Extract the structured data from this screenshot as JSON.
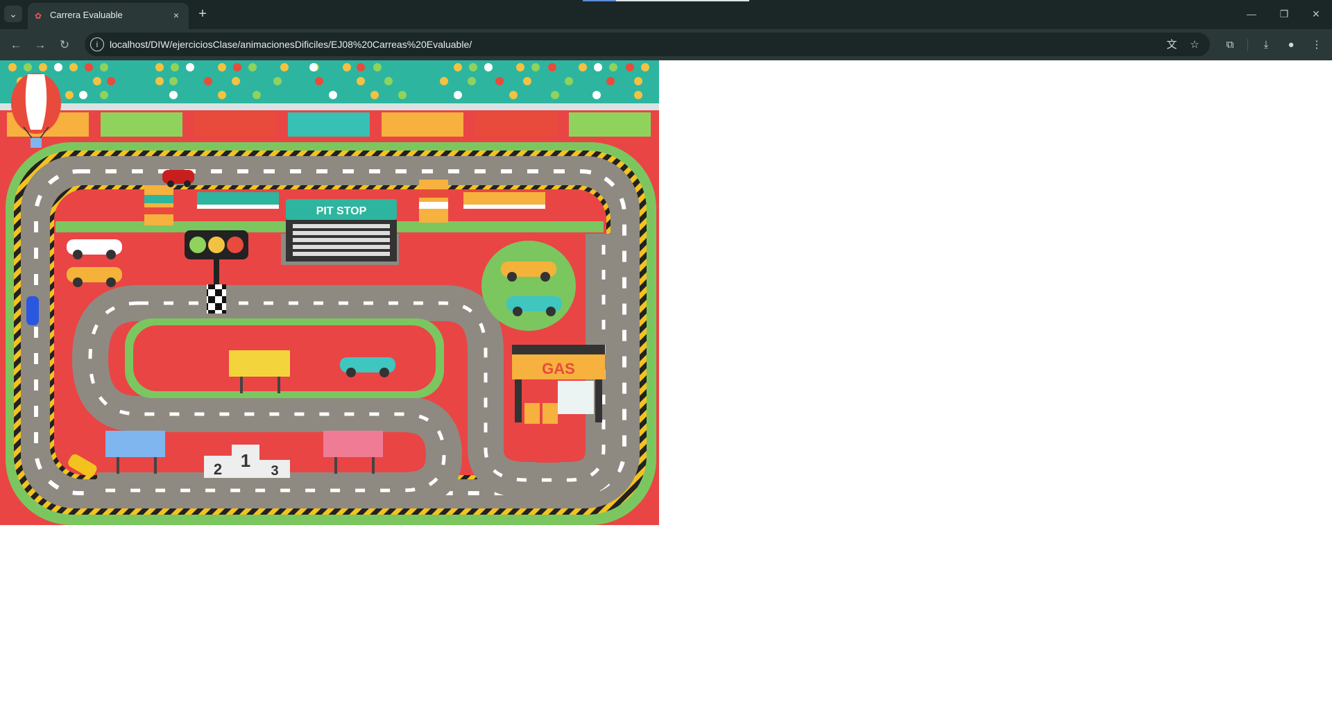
{
  "browser": {
    "tab_title": "Carrera Evaluable",
    "tab_close": "×",
    "new_tab": "+",
    "tab_list": "⌄",
    "url": "localhost/DIW/ejerciciosClase/animacionesDificiles/EJ08%20Carreas%20Evaluable/",
    "nav": {
      "back": "←",
      "forward": "→",
      "reload": "↻"
    },
    "window": {
      "minimize": "—",
      "restore": "❐",
      "close": "✕"
    },
    "icons": {
      "translate": "translate-icon",
      "bookmark": "star-icon",
      "extensions": "puzzle-icon",
      "downloads": "download-icon",
      "profile": "profile-icon",
      "menu": "kebab-menu-icon"
    }
  },
  "scene": {
    "pit_stop_label": "PIT STOP",
    "gas_label": "GAS",
    "podium": {
      "first": "1",
      "second": "2",
      "third": "3"
    },
    "colors": {
      "background_red": "#e94545",
      "grass": "#7cc660",
      "asphalt": "#8e8a82",
      "stands_teal": "#2eb59f"
    }
  }
}
